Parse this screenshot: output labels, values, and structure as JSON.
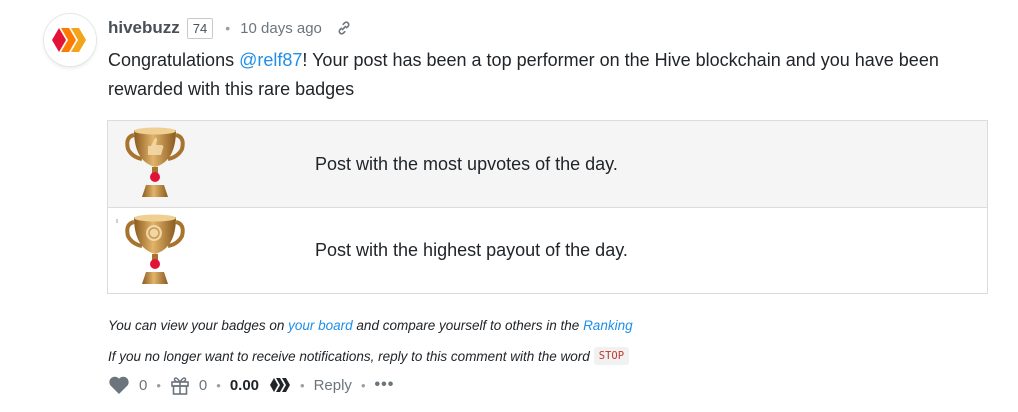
{
  "comment": {
    "author": "hivebuzz",
    "reputation": "74",
    "separator": "•",
    "time_ago": "10 days ago",
    "body_prefix": "Congratulations ",
    "mention": "@relf87",
    "body_suffix": "! Your post has been a top performer on the Hive blockchain and you have been rewarded with this rare badges"
  },
  "badges": [
    {
      "text": "Post with the most upvotes of the day.",
      "icon": "trophy-thumbs-up-icon"
    },
    {
      "text": "Post with the highest payout of the day.",
      "icon": "trophy-coin-icon"
    }
  ],
  "notes": {
    "line1_prefix": "You can view your badges on ",
    "board_link": "your board",
    "line1_middle": " and compare yourself to others in the ",
    "ranking_link": "Ranking",
    "line2_prefix": "If you no longer want to receive notifications, reply to this comment with the word",
    "stop_word": "STOP"
  },
  "footer": {
    "votes": "0",
    "gifts": "0",
    "payout": "0.00",
    "reply_label": "Reply",
    "more_label": "•••",
    "separator": "•"
  },
  "colors": {
    "link": "#1f8ee8",
    "hive_red": "#e31337",
    "trophy_gold": "#c58a3a",
    "stop_text": "#c0392b"
  }
}
